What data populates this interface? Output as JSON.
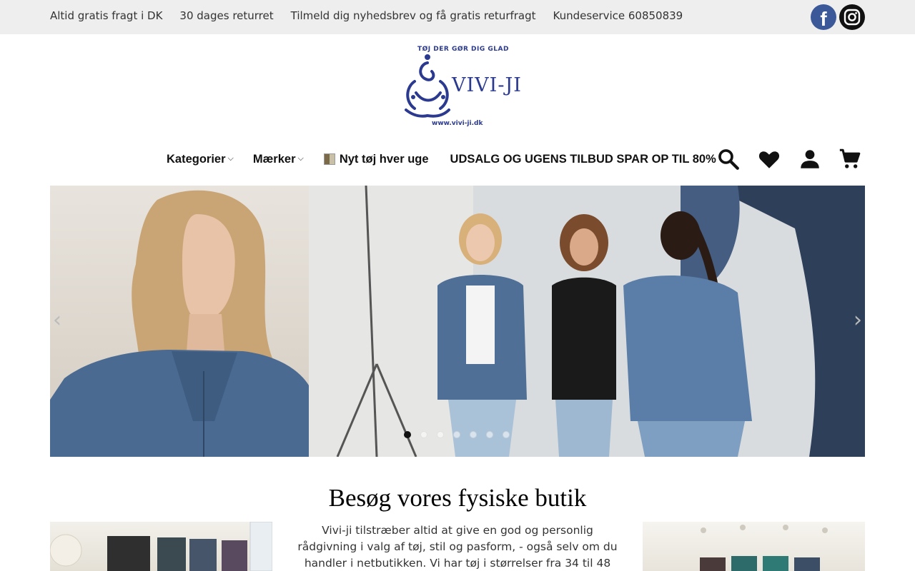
{
  "topbar": {
    "links": [
      "Altid gratis fragt i DK",
      "30 dages returret",
      "Tilmeld dig nyhedsbrev og få gratis returfragt",
      "Kundeservice 60850839"
    ],
    "social": [
      "facebook-icon",
      "instagram-icon"
    ]
  },
  "logo": {
    "tagline": "TØJ DER GØR DIG GLAD",
    "name": "VIVI-JI",
    "url": "www.vivi-ji.dk",
    "color": "#2b3a8f"
  },
  "nav": {
    "items": [
      {
        "label": "Kategorier",
        "has_dropdown": true
      },
      {
        "label": "Mærker",
        "has_dropdown": true
      },
      {
        "label": "Nyt tøj hver uge",
        "has_thumbnail": true
      },
      {
        "label": "UDSALG OG UGENS TILBUD SPAR OP TIL 80%"
      }
    ],
    "icons": [
      "search-icon",
      "heart-icon",
      "account-icon",
      "cart-icon"
    ]
  },
  "hero": {
    "slide_count": 7,
    "active_slide": 1
  },
  "visit": {
    "title": "Besøg vores fysiske butik",
    "text": "Vivi-ji tilstræber altid at give en god og personlig rådgivning i valg af tøj, stil og pasform, - også selv om du handler i netbutikken. Vi har tøj i størrelser fra 34 til 48"
  }
}
